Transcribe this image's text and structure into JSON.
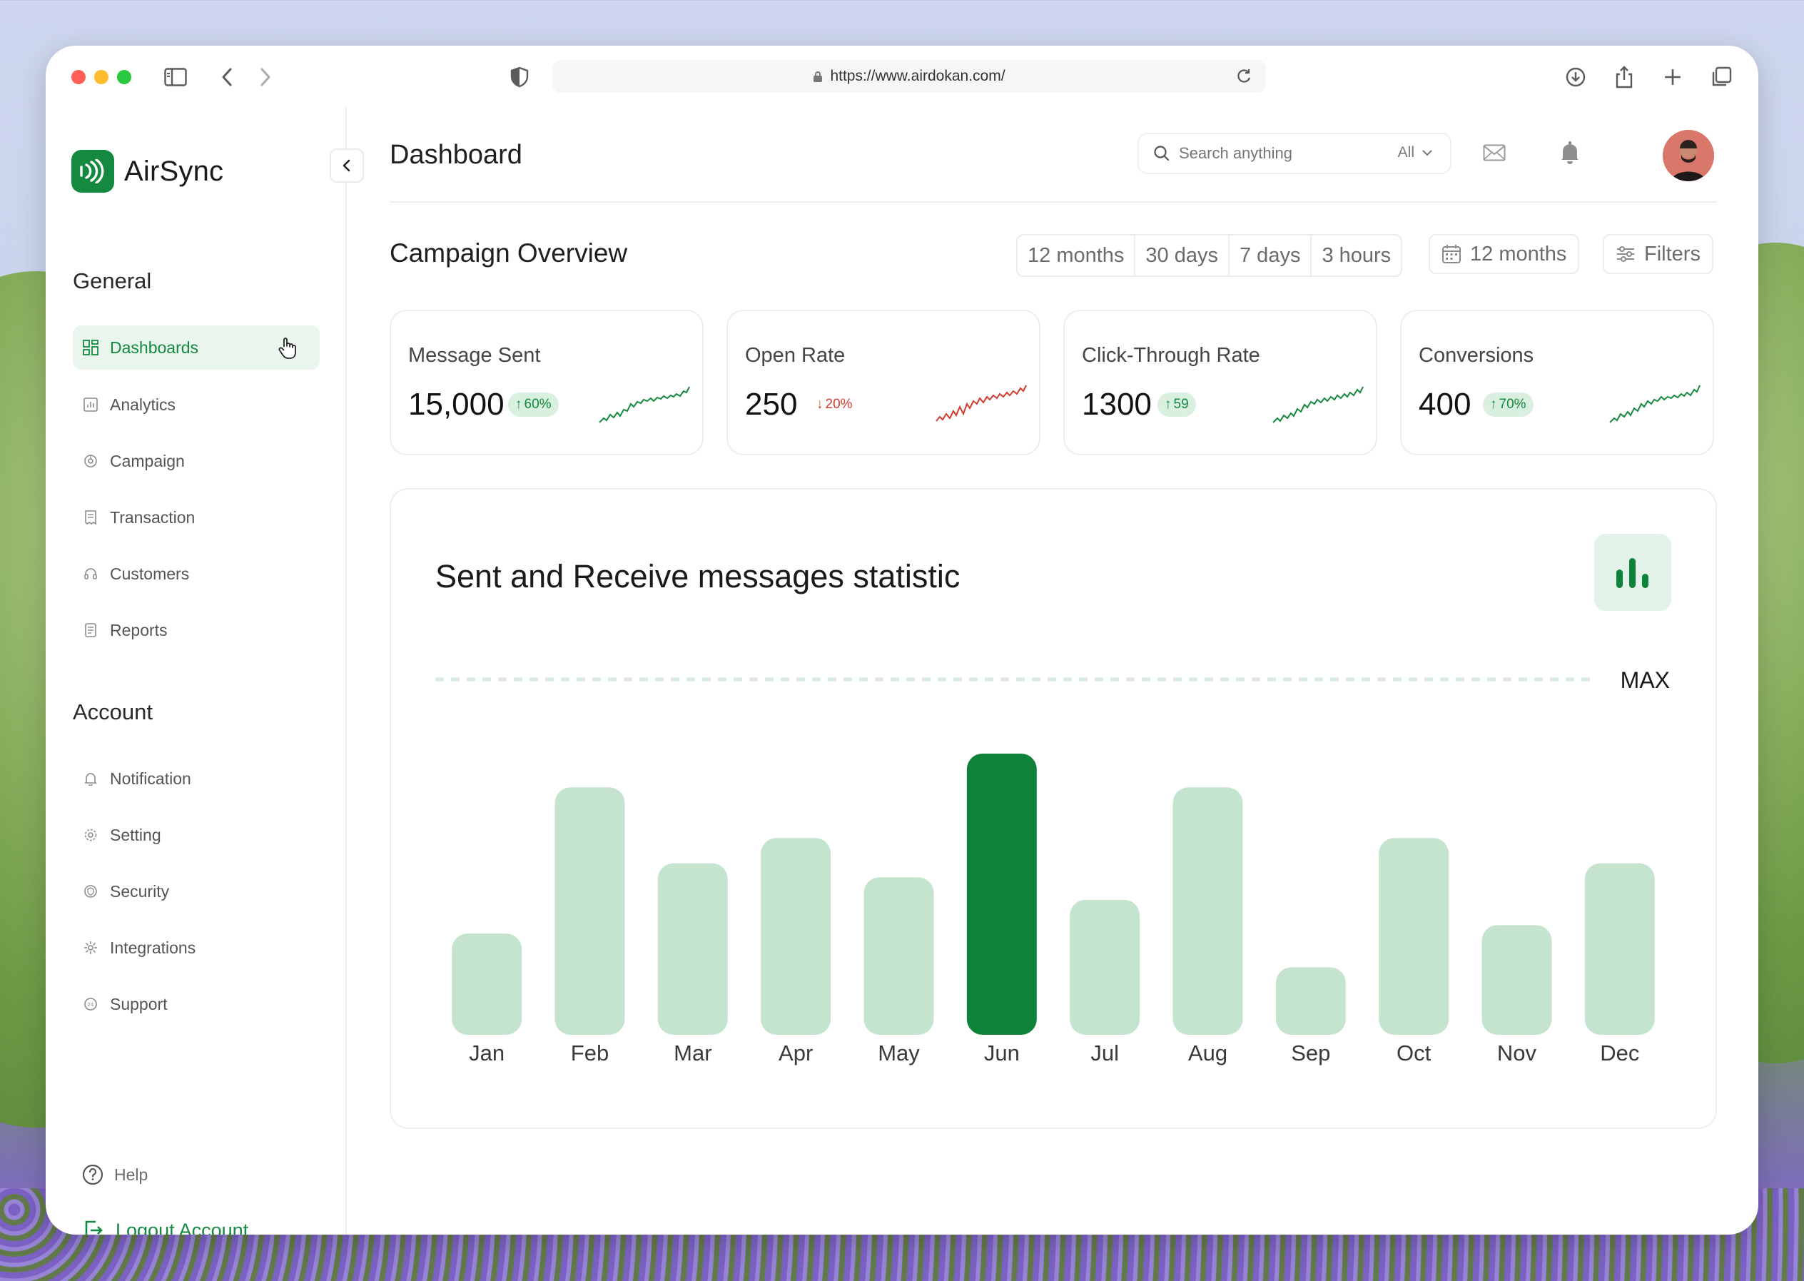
{
  "browser": {
    "url": "https://www.airdokan.com/"
  },
  "sidebar": {
    "brand": "AirSync",
    "general_title": "General",
    "general_items": [
      {
        "label": "Dashboards",
        "icon": "grid-icon",
        "active": true
      },
      {
        "label": "Analytics",
        "icon": "chart-icon"
      },
      {
        "label": "Campaign",
        "icon": "campaign-icon"
      },
      {
        "label": "Transaction",
        "icon": "receipt-icon"
      },
      {
        "label": "Customers",
        "icon": "headset-icon"
      },
      {
        "label": "Reports",
        "icon": "document-icon"
      }
    ],
    "account_title": "Account",
    "account_items": [
      {
        "label": "Notification",
        "icon": "bell-icon"
      },
      {
        "label": "Setting",
        "icon": "gear-icon"
      },
      {
        "label": "Security",
        "icon": "shield-icon"
      },
      {
        "label": "Integrations",
        "icon": "integration-icon"
      },
      {
        "label": "Support",
        "icon": "support-icon"
      }
    ],
    "help": "Help",
    "logout": "Logout Account"
  },
  "header": {
    "title": "Dashboard",
    "search_placeholder": "Search anything",
    "search_scope": "All"
  },
  "overview": {
    "title": "Campaign Overview",
    "ranges": [
      "12 months",
      "30 days",
      "7 days",
      "3 hours"
    ],
    "date_button": "12 months",
    "filters_button": "Filters",
    "kpis": [
      {
        "label": "Message Sent",
        "value": "15,000",
        "change": "60%",
        "direction": "up",
        "color": "#14893f"
      },
      {
        "label": "Open Rate",
        "value": "250",
        "change": "20%",
        "direction": "down",
        "color": "#d23b2e"
      },
      {
        "label": "Click-Through Rate",
        "value": "1300",
        "change": "59",
        "direction": "up",
        "color": "#14893f"
      },
      {
        "label": "Conversions",
        "value": "400",
        "change": "70%",
        "direction": "up",
        "color": "#14893f"
      }
    ]
  },
  "chart_data": {
    "type": "bar",
    "title": "Sent and Receive messages statistic",
    "categories": [
      "Jan",
      "Feb",
      "Mar",
      "Apr",
      "May",
      "Jun",
      "Jul",
      "Aug",
      "Sep",
      "Oct",
      "Nov",
      "Dec"
    ],
    "values": [
      36,
      88,
      61,
      70,
      56,
      100,
      48,
      88,
      24,
      70,
      39,
      61
    ],
    "highlight": "Jun",
    "max_label": "MAX",
    "ylim": [
      0,
      100
    ],
    "bar_color": "#c5e4d0",
    "highlight_color": "#0e8238"
  }
}
